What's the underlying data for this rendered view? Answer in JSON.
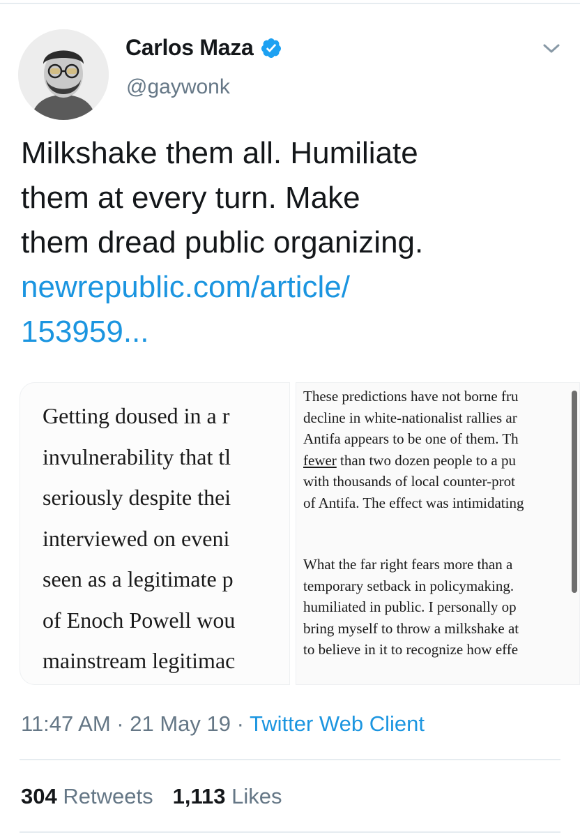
{
  "tweet": {
    "author": {
      "display_name": "Carlos Maza",
      "handle": "@gaywonk",
      "verified": true,
      "avatar_icon": "profile-photo"
    },
    "menu_icon": "chevron-down-icon",
    "text_lines": [
      "Milkshake them all. Humiliate",
      "them at every turn. Make",
      "them dread public organizing."
    ],
    "link_lines": [
      "newrepublic.com/article/",
      "153959..."
    ],
    "media": {
      "left_excerpt_lines": [
        "Getting doused in a r",
        "invulnerability that tl",
        "seriously despite thei",
        "interviewed on eveni",
        "seen as a legitimate p",
        "of Enoch Powell wou",
        "mainstream legitimac"
      ],
      "right_paragraph_1": [
        "These predictions have not borne fru",
        "decline in white-nationalist rallies ar",
        "Antifa appears to be one of them. Th",
        {
          "underlined": "fewer",
          "rest": " than two dozen people to a pu"
        },
        "with thousands of local counter-prot",
        "of Antifa. The effect was intimidating"
      ],
      "right_paragraph_2": [
        "What the far right fears more than a",
        "temporary setback in policymaking.",
        "humiliated in public. I personally op",
        "bring myself to throw a milkshake at",
        "to believe in it to recognize how effe"
      ]
    },
    "time": "11:47 AM",
    "separator": " · ",
    "date": "21 May 19",
    "client": "Twitter Web Client",
    "retweets": {
      "count": "304",
      "label": "Retweets"
    },
    "likes": {
      "count": "1,113",
      "label": "Likes"
    },
    "colors": {
      "link": "#1b95e0",
      "muted": "#657786",
      "text": "#14171a",
      "verified_badge": "#1da1f2",
      "divider": "#e6ecf0"
    }
  }
}
